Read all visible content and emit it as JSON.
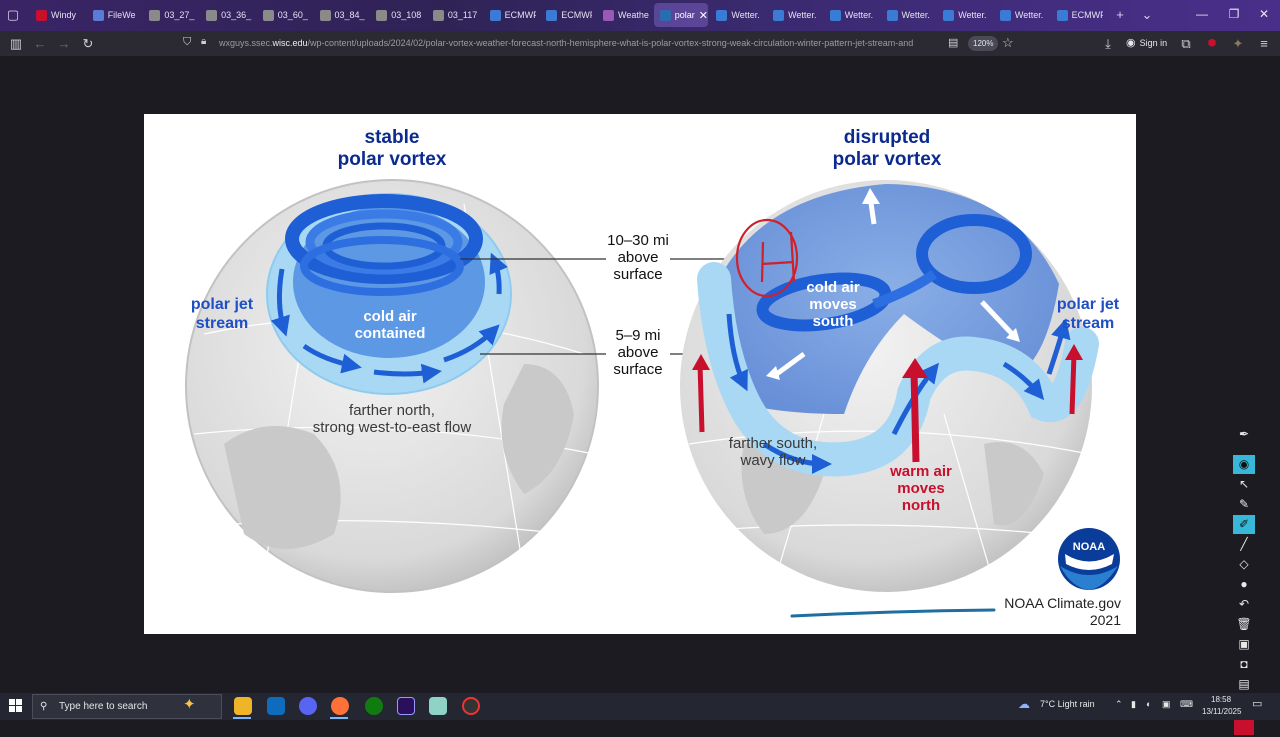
{
  "browser": {
    "tabs": [
      {
        "label": "Windy",
        "color": "#c8102e",
        "active": false
      },
      {
        "label": "FileWe",
        "color": "#5b7bd5",
        "active": false
      },
      {
        "label": "03_27_",
        "color": "#8a8a8a",
        "active": false
      },
      {
        "label": "03_36_",
        "color": "#8a8a8a",
        "active": false
      },
      {
        "label": "03_60_",
        "color": "#8a8a8a",
        "active": false
      },
      {
        "label": "03_84_",
        "color": "#8a8a8a",
        "active": false
      },
      {
        "label": "03_108",
        "color": "#8a8a8a",
        "active": false
      },
      {
        "label": "03_117",
        "color": "#8a8a8a",
        "active": false
      },
      {
        "label": "ECMWF",
        "color": "#3a7bd5",
        "active": false
      },
      {
        "label": "ECMWF",
        "color": "#3a7bd5",
        "active": false
      },
      {
        "label": "Weathersc",
        "color": "#9b59b6",
        "active": false
      },
      {
        "label": "polar",
        "color": "#2b6cb0",
        "active": true
      },
      {
        "label": "Wetter.",
        "color": "#3a7bd5",
        "active": false
      },
      {
        "label": "Wetter.",
        "color": "#3a7bd5",
        "active": false
      },
      {
        "label": "Wetter.",
        "color": "#3a7bd5",
        "active": false
      },
      {
        "label": "Wetter.",
        "color": "#3a7bd5",
        "active": false
      },
      {
        "label": "Wetter.",
        "color": "#3a7bd5",
        "active": false
      },
      {
        "label": "Wetter.",
        "color": "#3a7bd5",
        "active": false
      },
      {
        "label": "ECMWF",
        "color": "#3a7bd5",
        "active": false
      }
    ],
    "url_prefix": "wxguys.ssec.",
    "url_domain": "wisc.edu",
    "url_path": "/wp-content/uploads/2024/02/polar-vortex-weather-forecast-north-hemisphere-what-is-polar-vortex-strong-weak-circulation-winter-pattern-jet-stream-and",
    "zoom": "120%",
    "signin_label": "Sign in"
  },
  "figure": {
    "left_title": "stable\npolar vortex",
    "right_title": "disrupted\npolar vortex",
    "altitude_upper": "10–30 mi\nabove\nsurface",
    "altitude_lower": "5–9 mi\nabove\nsurface",
    "left_jet": "polar jet\nstream",
    "right_jet": "polar jet\nstream",
    "left_inner": "cold air\ncontained",
    "left_bottom": "farther north,\nstrong west-to-east flow",
    "right_cold": "cold air\nmoves\nsouth",
    "right_bottom": "farther south,\nwavy flow",
    "right_warm": "warm air\nmoves\nnorth",
    "logo_text": "NOAA",
    "credit": "NOAA Climate.gov\n2021"
  },
  "taskbar": {
    "search_placeholder": "Type here to search",
    "weather": "7°C  Light rain",
    "time": "18:58",
    "date": "13/11/2025"
  },
  "colors": {
    "title_blue": "#0b2a8f",
    "jet_light": "#9fd3f2",
    "vortex_blue": "#1f5fd6",
    "warm_red": "#c8102e",
    "annotation_red": "#d0202a",
    "underline": "#1e6fa0"
  },
  "icons": [
    "lock-icon",
    "star-icon",
    "download-icon",
    "account-icon",
    "extensions-icon",
    "menu-icon",
    "search-icon",
    "windows-start-icon"
  ]
}
